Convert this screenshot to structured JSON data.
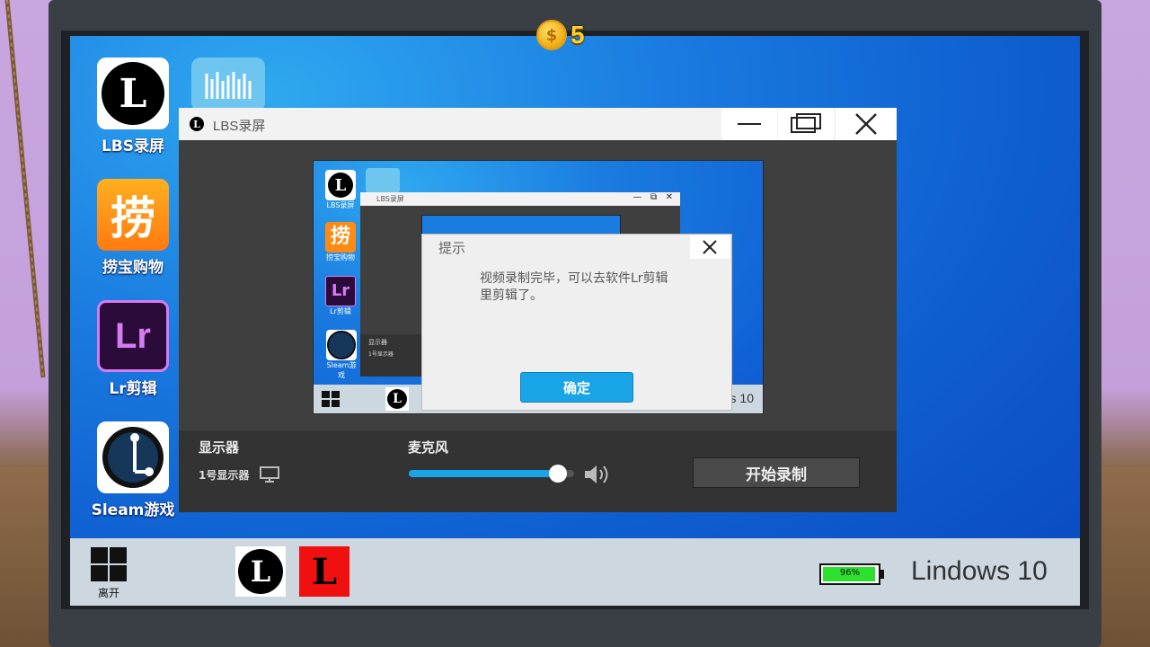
{
  "coins": {
    "count": "5",
    "symbol": "$"
  },
  "desktop": {
    "icons": [
      {
        "label": "LBS录屏",
        "glyph": "L"
      },
      {
        "label": "",
        "glyph": "|||"
      },
      {
        "label": "捞宝购物",
        "glyph": "捞"
      },
      {
        "label": "Lr剪辑",
        "glyph": "Lr"
      },
      {
        "label": "Sleam游戏",
        "glyph": "steam"
      }
    ]
  },
  "window": {
    "title": "LBS录屏",
    "buttons": {
      "minimize": "—",
      "restore": "⧉",
      "close": "✕"
    },
    "controls": {
      "display_label": "显示器",
      "display_value": "1号显示器",
      "mic_label": "麦克风",
      "mic_level": 0.9,
      "record_button": "开始录制"
    }
  },
  "preview": {
    "window_title": "LBS录屏",
    "icons": [
      "LBS录屏",
      "捞宝购物",
      "Lr剪辑",
      "Sleam游戏"
    ],
    "display_label": "显示器",
    "display_value": "1号显示器",
    "taskbar_text": "s 10"
  },
  "dialog": {
    "title": "提示",
    "message": "视频录制完毕，可以去软件Lr剪辑里剪辑了。",
    "ok": "确定",
    "close": "✕"
  },
  "taskbar": {
    "start_label": "离开",
    "battery": "96%",
    "battery_level": 0.96,
    "os_name": "Lindows 10"
  },
  "colors": {
    "accent": "#1aa4e8",
    "ok_button": "#1aa4e8",
    "battery_green": "#2ee02e"
  }
}
